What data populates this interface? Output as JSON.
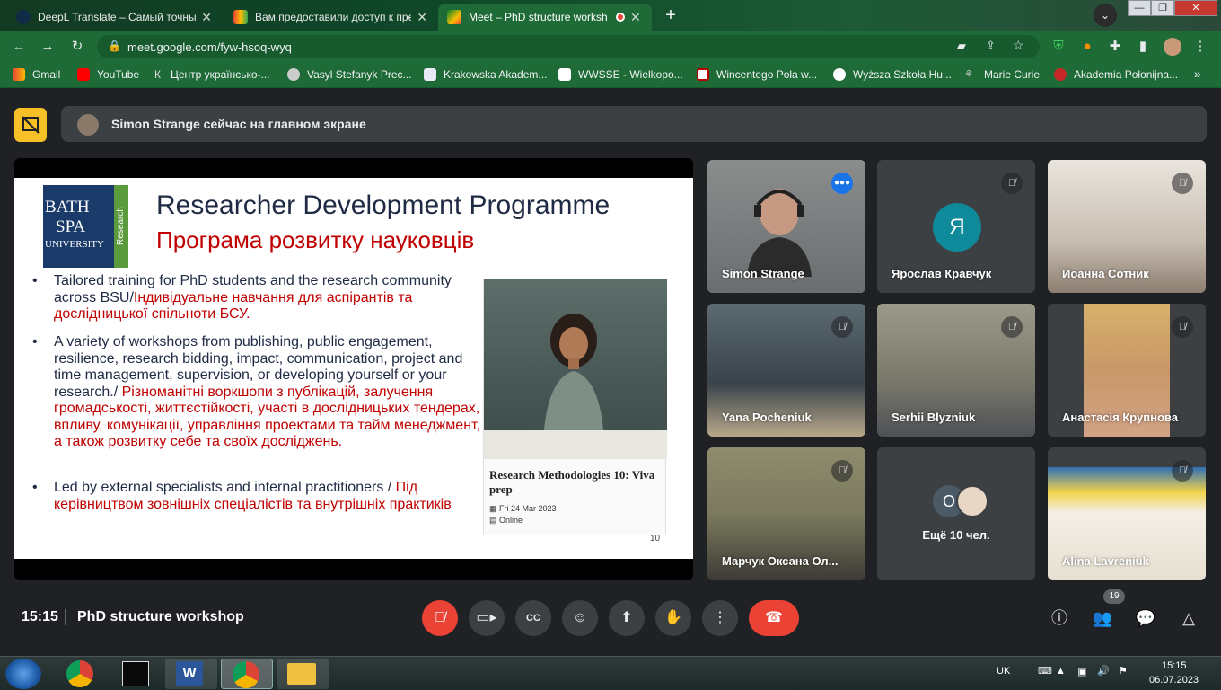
{
  "browser": {
    "tabs": [
      {
        "title": "DeepL Translate – Самый точный",
        "icon": "deepl-icon"
      },
      {
        "title": "Вам предоставили доступ к пре",
        "icon": "gmail-icon"
      },
      {
        "title": "Meet – PhD structure worksh",
        "icon": "meet-icon",
        "active": true
      }
    ],
    "new_tab": "+",
    "url": "meet.google.com/fyw-hsoq-wyq",
    "bookmarks": [
      "Gmail",
      "YouTube",
      "Центр українсько-...",
      "Vasyl Stefanyk Prec...",
      "Krakowska Akadem...",
      "WWSSE - Wielkopo...",
      "Wincentego Pola w...",
      "Wyższa Szkoła Hu...",
      "Marie Curie",
      "Akademia Polonijna..."
    ],
    "more": "»"
  },
  "meet": {
    "banner_text": "Simon Strange сейчас на главном экране",
    "slide": {
      "logo_lines": [
        "BATH",
        "SPA",
        "UNIVERSITY"
      ],
      "logo_side": "Research",
      "title_en": "Researcher Development Programme",
      "title_ua": "Програма розвитку науковців",
      "bullets": [
        {
          "en": "Tailored training for PhD students and the research community across BSU/",
          "ua": "Індивідуальне навчання для аспірантів та дослідницької спільноти БСУ."
        },
        {
          "en": "A variety of workshops from publishing, public engagement, resilience, research bidding, impact, communication, project and time management, supervision, or developing yourself or your research./ ",
          "ua": "Різноманітні воркшопи з публікацій, залучення громадськості, життєстійкості, участі в дослідницьких тендерах, впливу, комунікації, управління проектами та тайм менеджмент, а також розвитку себе та своїх досліджень."
        },
        {
          "en": "Led by external specialists and internal practitioners / ",
          "ua": "Під керівництвом зовнішніх спеціалістів та внутрішніх практиків"
        }
      ],
      "card_title": "Research Methodologies 10: Viva prep",
      "card_date": "Fri 24 Mar 2023",
      "card_mode": "Online",
      "page_number": "10"
    },
    "participants": [
      {
        "name": "Simon Strange",
        "type": "video",
        "speaking": true
      },
      {
        "name": "Ярослав Кравчук",
        "type": "avatar",
        "letter": "Я",
        "color": "#0f8a9a"
      },
      {
        "name": "Иоанна Сотник",
        "type": "video"
      },
      {
        "name": "Yana Pocheniuk",
        "type": "video"
      },
      {
        "name": "Serhii Blyzniuk",
        "type": "video"
      },
      {
        "name": "Анастасія Крупнова",
        "type": "video"
      },
      {
        "name": "Марчук Оксана Ол...",
        "type": "video"
      },
      {
        "name": "Ещё 10 чел.",
        "type": "more",
        "letter": "О"
      },
      {
        "name": "Alina Lavreniuk",
        "type": "video"
      }
    ],
    "time": "15:15",
    "meeting_title": "PhD structure workshop",
    "participant_count": "19"
  },
  "taskbar": {
    "lang": "UK",
    "time": "15:15",
    "date": "06.07.2023"
  },
  "colors": {
    "chrome_green": "#1f6b38",
    "meet_bg": "#202124",
    "end_call_red": "#ea4335",
    "pin_yellow": "#f6c026",
    "slide_red": "#c00000",
    "slide_navy": "#1f2a44"
  }
}
